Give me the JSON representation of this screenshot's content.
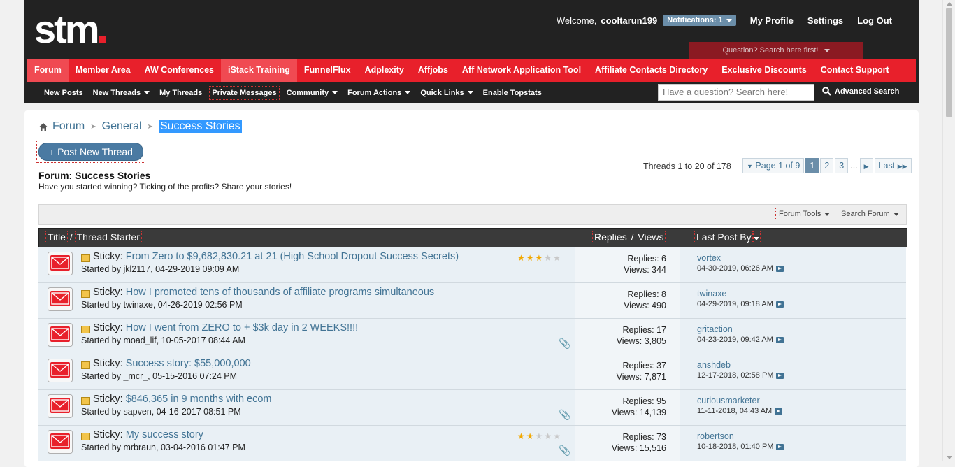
{
  "header": {
    "logo": "stm",
    "welcome": "Welcome,",
    "username": "cooltarun199",
    "notifications": "Notifications: 1",
    "links": [
      "My Profile",
      "Settings",
      "Log Out"
    ],
    "question_bar": "Question? Search here first!"
  },
  "nav": {
    "items": [
      "Forum",
      "Member Area",
      "AW Conferences",
      "iStack Training",
      "FunnelFlux",
      "Adplexity",
      "Affjobs",
      "Aff Network Application Tool",
      "Affiliate Contacts Directory",
      "Exclusive Discounts",
      "Contact Support"
    ]
  },
  "subnav": {
    "items": [
      "New Posts",
      "New Threads",
      "My Threads",
      "Private Messages",
      "Community",
      "Forum Actions",
      "Quick Links",
      "Enable Topstats"
    ],
    "search_placeholder": "Have a question? Search here!",
    "advanced_search": "Advanced Search"
  },
  "breadcrumb": {
    "forum": "Forum",
    "general": "General",
    "current": "Success Stories"
  },
  "post_button": "+ Post New Thread",
  "forum": {
    "title": "Forum: Success Stories",
    "description": "Have you started winning? Ticking of the profits? Share your stories!",
    "thread_count": "Threads 1 to 20 of 178"
  },
  "pagination": {
    "page_of": "Page 1 of 9",
    "pages": [
      "1",
      "2",
      "3"
    ],
    "dots": "...",
    "last": "Last"
  },
  "tools": {
    "forum_tools": "Forum Tools",
    "search_forum": "Search Forum"
  },
  "columns": {
    "title": "Title",
    "thread_starter": "Thread Starter",
    "replies": "Replies",
    "views": "Views",
    "last_post_by": "Last Post By"
  },
  "threads": [
    {
      "prefix": "Sticky:",
      "title": "From Zero to $9,682,830.21 at 21 (High School Dropout Success Secrets)",
      "started": "Started by jkl2117, 04-29-2019 09:09 AM",
      "replies": "Replies: 6",
      "views": "Views: 344",
      "last_user": "vortex",
      "last_date": "04-30-2019, 06:26 AM",
      "rating": 3,
      "clip": false
    },
    {
      "prefix": "Sticky:",
      "title": "How I promoted tens of thousands of affiliate programs simultaneous",
      "started": "Started by twinaxe, 04-26-2019 02:56 PM",
      "replies": "Replies: 8",
      "views": "Views: 490",
      "last_user": "twinaxe",
      "last_date": "04-29-2019, 09:18 AM",
      "rating": 0,
      "clip": false
    },
    {
      "prefix": "Sticky:",
      "title": "How I went from ZERO to + $3k day in 2 WEEKS!!!!",
      "started": "Started by moad_lif, 10-05-2017 08:44 AM",
      "replies": "Replies: 17",
      "views": "Views: 3,805",
      "last_user": "gritaction",
      "last_date": "04-23-2019, 09:42 AM",
      "rating": 0,
      "clip": true
    },
    {
      "prefix": "Sticky:",
      "title": "Success story: $55,000,000",
      "started": "Started by _mcr_, 05-15-2016 07:24 PM",
      "replies": "Replies: 37",
      "views": "Views: 7,871",
      "last_user": "anshdeb",
      "last_date": "12-17-2018, 02:58 PM",
      "rating": 0,
      "clip": false
    },
    {
      "prefix": "Sticky:",
      "title": "$846,365 in 9 months with ecom",
      "started": "Started by sapven, 04-16-2017 08:51 PM",
      "replies": "Replies: 95",
      "views": "Views: 14,139",
      "last_user": "curiousmarketer",
      "last_date": "11-11-2018, 04:43 AM",
      "rating": 0,
      "clip": true
    },
    {
      "prefix": "Sticky:",
      "title": "My success story",
      "started": "Started by mrbraun, 03-04-2016 01:47 PM",
      "replies": "Replies: 73",
      "views": "Views: 15,516",
      "last_user": "robertson",
      "last_date": "10-18-2018, 01:40 PM",
      "rating": 2,
      "clip": true
    }
  ],
  "colors": {
    "brand_red": "#e8202b",
    "link_blue": "#417394",
    "header_dark": "#222222"
  }
}
